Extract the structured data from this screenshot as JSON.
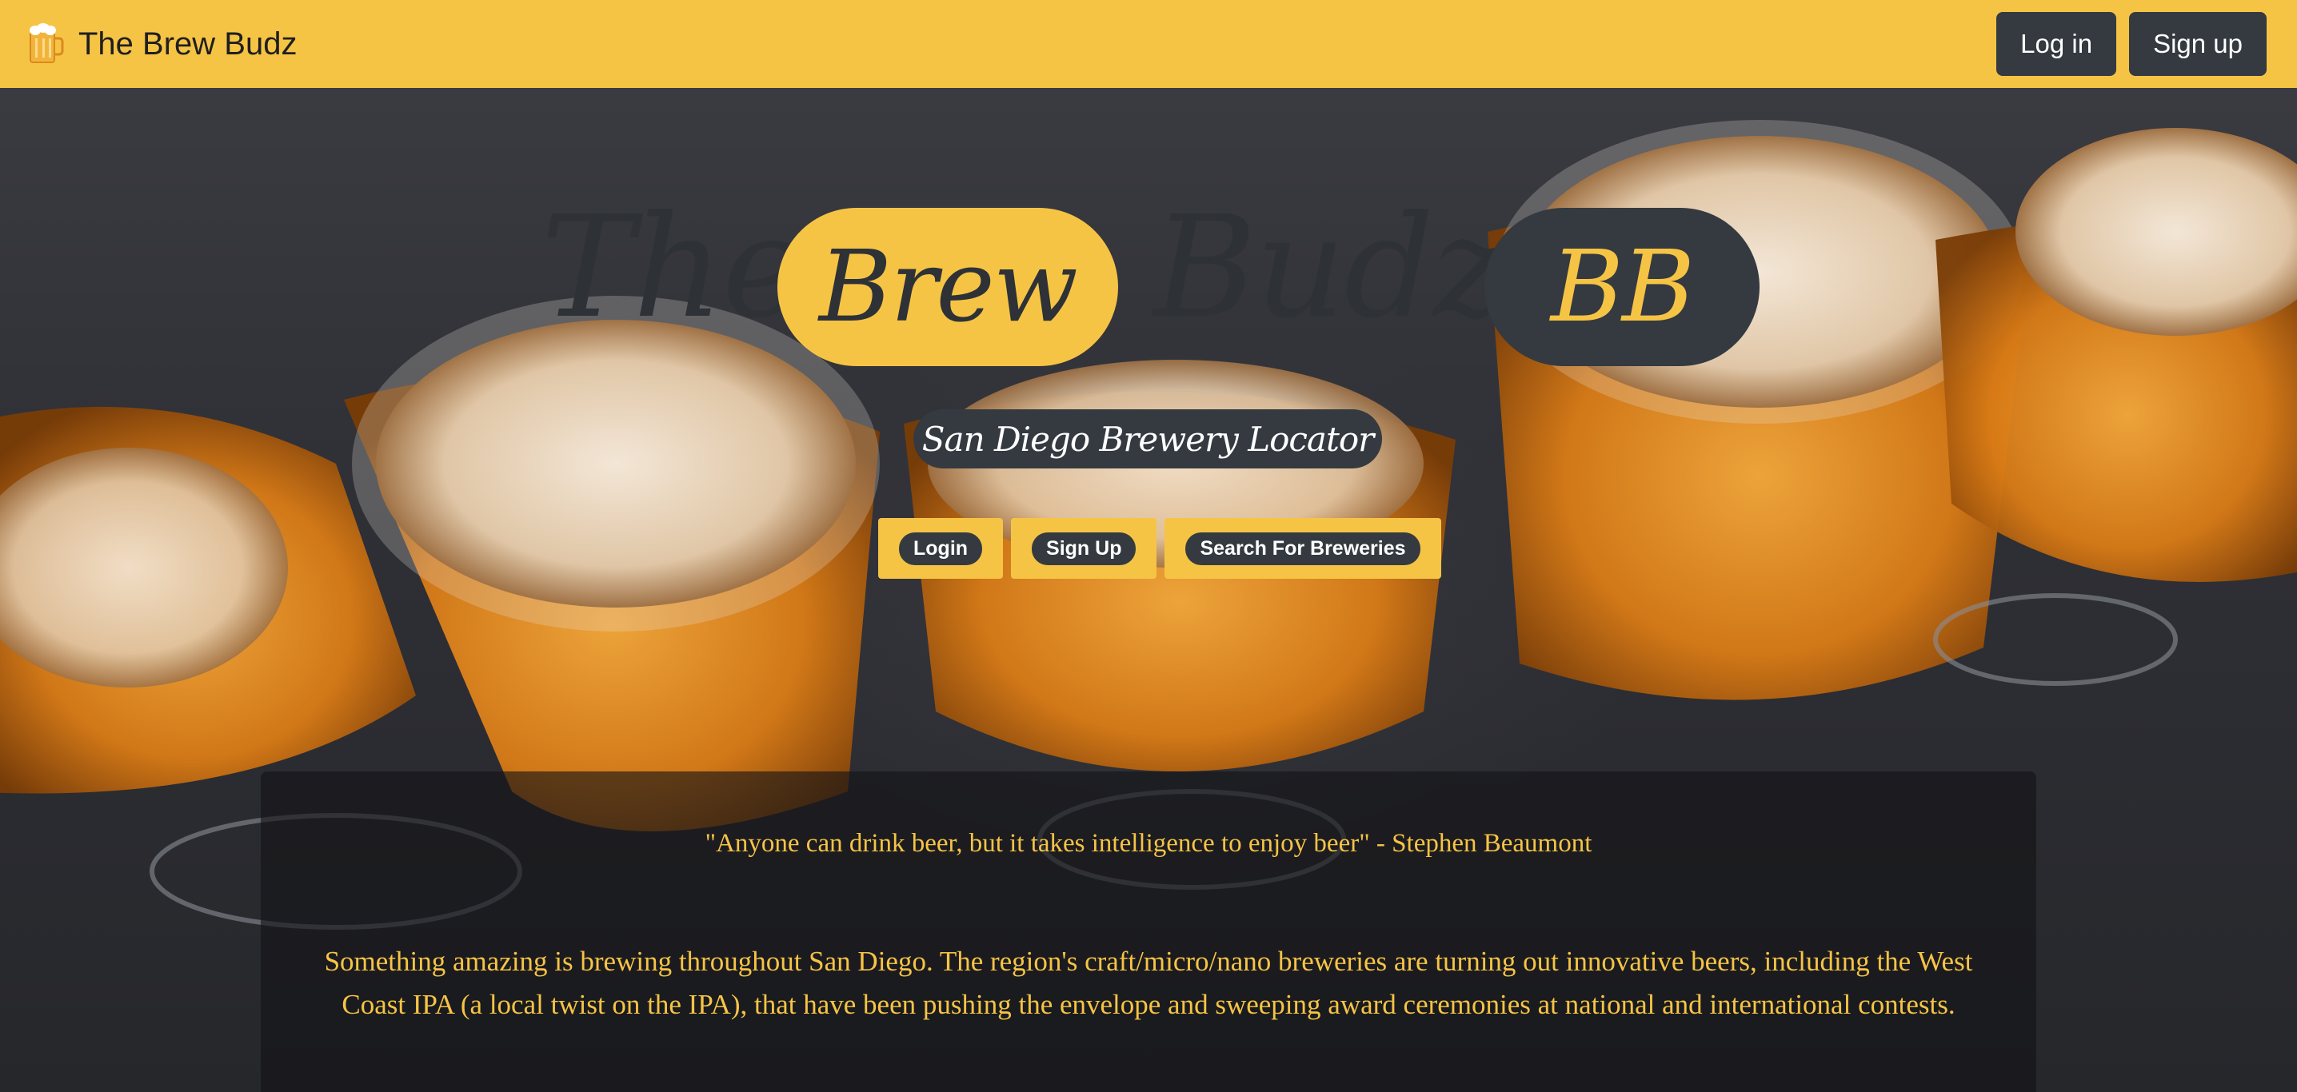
{
  "navbar": {
    "brand_icon": "beer-mug-icon",
    "brand_text": "The Brew Budz",
    "login_label": "Log in",
    "signup_label": "Sign up"
  },
  "hero": {
    "background": "beer-glasses-photo",
    "title_the": "The",
    "title_brew": "Brew",
    "title_budz": "Budz",
    "badge": "BB",
    "subtitle": "San Diego Brewery Locator",
    "buttons": {
      "login": "Login",
      "signup": "Sign Up",
      "search": "Search For Breweries"
    }
  },
  "info": {
    "quote": "\"Anyone can drink beer, but it takes intelligence to enjoy beer\" - Stephen Beaumont",
    "paragraph": "Something amazing is brewing throughout San Diego. The region's craft/micro/nano breweries are turning out innovative beers, including the West Coast IPA (a local twist on the IPA), that have been pushing the envelope and sweeping award ceremonies at national and international contests."
  },
  "colors": {
    "accent": "#f6c445",
    "dark": "#343a40",
    "text_dark": "#2e3237"
  }
}
